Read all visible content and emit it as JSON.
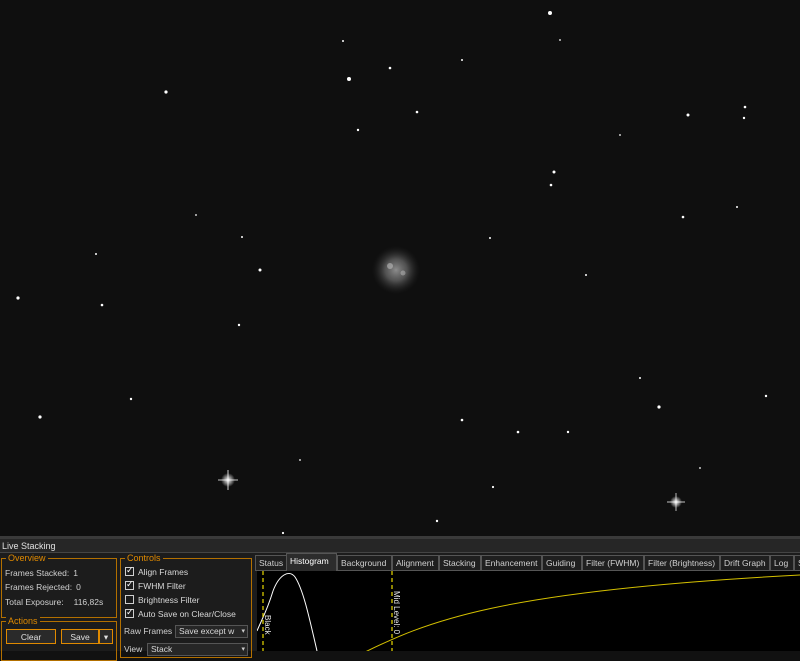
{
  "panel_title": "Live Stacking",
  "overview": {
    "label": "Overview",
    "frames_stacked_label": "Frames Stacked:",
    "frames_stacked": "1",
    "frames_rejected_label": "Frames Rejected:",
    "frames_rejected": "0",
    "total_exposure_label": "Total Exposure:",
    "total_exposure": "116,82s"
  },
  "actions": {
    "label": "Actions",
    "clear_label": "Clear",
    "save_label": "Save",
    "save_dropdown": "▾"
  },
  "controls": {
    "label": "Controls",
    "align_frames": "Align Frames",
    "fwhm_filter": "FWHM Filter",
    "brightness_filter": "Brightness Filter",
    "auto_save": "Auto Save on Clear/Close",
    "raw_frames_label": "Raw Frames",
    "raw_frames_value": "Save except w",
    "view_label": "View",
    "view_value": "Stack",
    "checked": {
      "align_frames": true,
      "fwhm_filter": true,
      "brightness_filter": false,
      "auto_save": true
    }
  },
  "tabs": [
    "Status",
    "Histogram",
    "Background",
    "Alignment",
    "Stacking",
    "Enhancement",
    "Guiding",
    "Filter (FWHM)",
    "Filter (Brightness)",
    "Drift Graph",
    "Log",
    "S"
  ],
  "active_tab": "Histogram",
  "histogram": {
    "black_label": "Black",
    "mid_label": "Mid Level: 0",
    "colors": {
      "curve": "#ffffff",
      "stretch": "#d4c000",
      "marker": "#e8d800",
      "accent": "#e08a00"
    }
  }
}
